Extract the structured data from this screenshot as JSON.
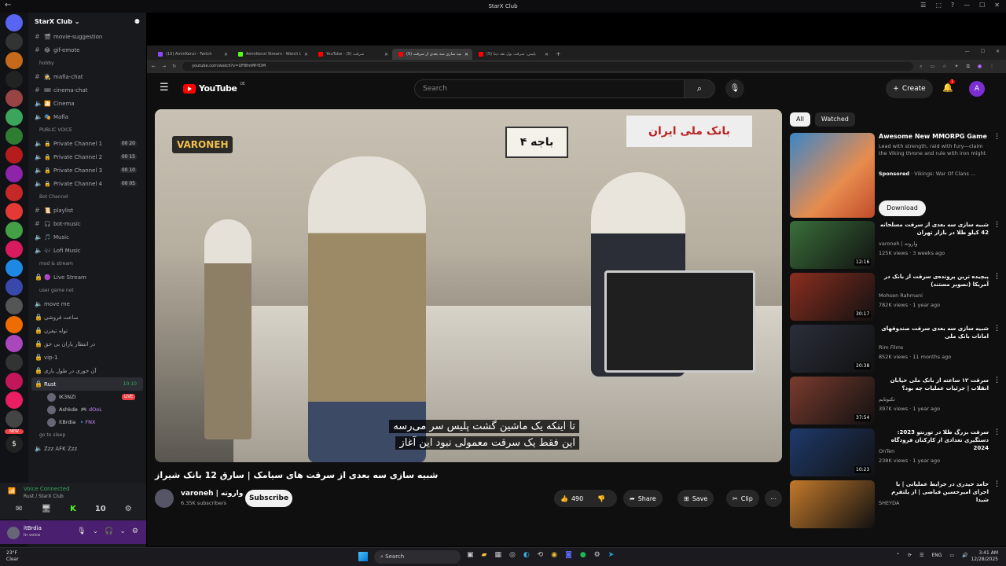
{
  "window": {
    "title": "StarX Club",
    "back": "←",
    "controls": [
      "☰",
      "⬚",
      "?",
      "—",
      "☐",
      "✕"
    ]
  },
  "servers": [
    {
      "label": "",
      "color": "#5865f2"
    },
    {
      "label": "",
      "color": "#333"
    },
    {
      "label": "",
      "color": "#c46a1a"
    },
    {
      "label": "",
      "color": "#222"
    },
    {
      "label": "",
      "color": "#944"
    },
    {
      "label": "",
      "color": "#3ba55c"
    },
    {
      "label": "",
      "color": "#2e7d32"
    },
    {
      "label": "",
      "color": "#b71c1c"
    },
    {
      "label": "",
      "color": "#8e24aa"
    },
    {
      "label": "",
      "color": "#c62828"
    },
    {
      "label": "",
      "color": "#e53935"
    },
    {
      "label": "",
      "color": "#43a047"
    },
    {
      "label": "",
      "color": "#d81b60"
    },
    {
      "label": "",
      "color": "#1e88e5"
    },
    {
      "label": "",
      "color": "#3949ab"
    },
    {
      "label": "",
      "color": "#555"
    },
    {
      "label": "",
      "color": "#ef6c00"
    },
    {
      "label": "",
      "color": "#ab47bc"
    },
    {
      "label": "",
      "color": "#333"
    },
    {
      "label": "",
      "color": "#c2185b"
    },
    {
      "label": "",
      "color": "#e91e63"
    },
    {
      "label": "",
      "color": "#444"
    },
    {
      "label": "$",
      "color": "#222"
    }
  ],
  "server": {
    "name": "StarX Club ⌄",
    "new_badge": "NEW"
  },
  "channels": [
    {
      "kind": "text",
      "name": "movie-suggestion",
      "emoji": "🎬"
    },
    {
      "kind": "text",
      "name": "gif-emote",
      "emoji": "😂"
    },
    {
      "kind": "cat",
      "name": "hobby"
    },
    {
      "kind": "text",
      "name": "mafia-chat",
      "emoji": "🕵"
    },
    {
      "kind": "text",
      "name": "cinema-chat",
      "emoji": "🎟"
    },
    {
      "kind": "voice",
      "name": "Cinema",
      "emoji": "🎦"
    },
    {
      "kind": "voice",
      "name": "Mafia",
      "emoji": "🎭"
    },
    {
      "kind": "cat",
      "name": "PUBLIC VOICE"
    },
    {
      "kind": "voice",
      "name": "Private Channel 1",
      "emoji": "🔒",
      "count": "00 20"
    },
    {
      "kind": "voice",
      "name": "Private Channel 2",
      "emoji": "🔒",
      "count": "00 15"
    },
    {
      "kind": "voice",
      "name": "Private Channel 3",
      "emoji": "🔒",
      "count": "00 10"
    },
    {
      "kind": "voice",
      "name": "Private Channel 4",
      "emoji": "🔒",
      "count": "00 05"
    },
    {
      "kind": "cat",
      "name": "Bot Channel"
    },
    {
      "kind": "text",
      "name": "playlist",
      "emoji": "📜"
    },
    {
      "kind": "text",
      "name": "bot-music",
      "emoji": "🎧"
    },
    {
      "kind": "voice",
      "name": "Music",
      "emoji": "🎵"
    },
    {
      "kind": "voice",
      "name": "Lofi Music",
      "emoji": "🎶"
    },
    {
      "kind": "cat",
      "name": "mod & stream"
    },
    {
      "kind": "lock",
      "name": "Live Stream",
      "emoji": "🟣"
    },
    {
      "kind": "cat",
      "name": "user game net"
    },
    {
      "kind": "voice",
      "name": "move me",
      "emoji": ""
    },
    {
      "kind": "lock",
      "name": "ساعت فروشی",
      "emoji": ""
    },
    {
      "kind": "lock",
      "name": "توله تیغزن",
      "emoji": ""
    },
    {
      "kind": "lock",
      "name": "در انتظار یاران بی حق",
      "emoji": ""
    },
    {
      "kind": "lock",
      "name": "vip-1",
      "emoji": ""
    },
    {
      "kind": "lock",
      "name": "آن خوری در طول باری",
      "emoji": ""
    },
    {
      "kind": "active",
      "name": "Rust",
      "emoji": "",
      "timer": "10:10"
    }
  ],
  "voice_users": [
    {
      "name": "iK3NZI",
      "tag": "",
      "live": "LIVE"
    },
    {
      "name": "Ashkde",
      "tag": "🎮 dOoL",
      "live": ""
    },
    {
      "name": "itBrdia",
      "tag": "🔹FNX",
      "live": ""
    }
  ],
  "channels_after": [
    {
      "kind": "cat",
      "name": "go to sleep"
    },
    {
      "kind": "voice",
      "name": "Zzz AFK Zzz",
      "emoji": ""
    }
  ],
  "voice_panel": {
    "status": "Voice Connected",
    "sub": "Rust / StarX Club",
    "buttons": [
      "✉",
      "🖥",
      "K",
      "10",
      "⚙"
    ]
  },
  "user_panel": {
    "name": "itBrdia",
    "status": "In voice",
    "icons": [
      "🎙",
      "⌄",
      "🎧",
      "⌄",
      "⚙"
    ]
  },
  "browser": {
    "tabs": [
      {
        "title": "(10) AminKenzi - Twitch",
        "active": false,
        "color": "#9146ff"
      },
      {
        "title": "AminKenzi Stream - Watch Liv...",
        "active": false,
        "color": "#53fc18"
      },
      {
        "title": "YouTube - سرقت (5)",
        "active": false,
        "color": "#f00"
      },
      {
        "title": "شبیه سازی سه بعدی از سرقت (5)",
        "active": true,
        "color": "#f00"
      },
      {
        "title": "پلیس: سرقت پول نقد دیتا (5)",
        "active": false,
        "color": "#f00"
      }
    ],
    "url": "youtube.com/watch?v=UF8fmMf-YDM"
  },
  "youtube": {
    "logo_text": "YouTube",
    "region": "DE",
    "search_placeholder": "Search",
    "create_label": "Create",
    "bell_count": "1",
    "avatar_letter": "A",
    "video": {
      "watermark": "VARONEH",
      "sign1": "باجه ۴",
      "sign2": "بانک ملی ایران",
      "subtitle_line1": "تا اینکه یک ماشین گشت پلیس سر می‌رسه",
      "subtitle_line2": "این فقط یک سرقت معمولی نبود این آغاز",
      "title": "شبیه سازی سه بعدی از سرقت های سیامک | سارق 12 بانک شیراز",
      "channel": "varoneh | واروته",
      "subscribers": "6.35K subscribers",
      "subscribe": "Subscribe",
      "likes": "490",
      "share": "Share",
      "save": "Save",
      "clip": "Clip"
    },
    "chips": [
      "All",
      "Watched"
    ],
    "ad": {
      "title": "Awesome New MMORPG Game",
      "desc": "Lead with strength, raid with fury—claim the Viking throne and rule with iron might",
      "sponsored": "Sponsored",
      "sponsor": "· Vikings: War Of Clans ...",
      "download": "Download"
    },
    "recs": [
      {
        "title": "شبیه سازی سه بعدی از سرقت مسلحانه 42 کیلو طلا در بازار تهران",
        "channel": "varoneh | واروته",
        "meta": "125K views · 3 weeks ago",
        "dur": "12:16",
        "color": "#3a6f3a"
      },
      {
        "title": "پیچیده ترین پرونده‌ی سرقت از بانک در آمریکا (تصویر مستند)",
        "channel": "Mohsen Rahmani",
        "meta": "782K views · 1 year ago",
        "dur": "30:17",
        "color": "#8b2e1f"
      },
      {
        "title": "شبیه سازی سه بعدی سرقت صندوقهای امانات بانک ملی",
        "channel": "Rim Films",
        "meta": "852K views · 11 months ago",
        "dur": "20:38",
        "color": "#2a2e3a"
      },
      {
        "title": "سرقت ۱۲ ساعته از بانک ملی خیابان انقلاب | جزئیات عملیات چه بود؟",
        "channel": "تکنوتایم",
        "meta": "397K views · 1 year ago",
        "dur": "37:54",
        "color": "#7a3b2e"
      },
      {
        "title": "سرقت بزرگ طلا در تورنتو 2023: دستگیری تعدادی از کارکنان فرودگاه 2024",
        "channel": "OnTen",
        "meta": "238K views · 1 year ago",
        "dur": "10:23",
        "color": "#1f3a6b"
      },
      {
        "title": "حامد حیدری در جرایط عملیاتی | با اجرای امیرحسین فیاضی | از پلتفرم شیدا",
        "channel": "SHEYDA",
        "meta": "",
        "dur": "",
        "color": "#c47a2a"
      }
    ]
  },
  "taskbar": {
    "weather_temp": "23°F",
    "weather_desc": "Clear",
    "search": "Search",
    "lang": "ENG",
    "time": "3:41 AM",
    "date": "12/28/2025"
  }
}
